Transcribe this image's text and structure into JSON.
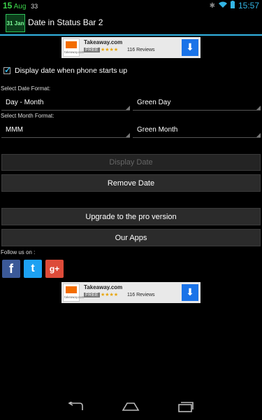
{
  "status_bar": {
    "date_day": "15",
    "date_month": "Aug",
    "battery_left": "33",
    "time": "15:57"
  },
  "action_bar": {
    "icon_text": "31 Jan",
    "title": "Date in Status Bar 2"
  },
  "ads": [
    {
      "name": "Takeaway.com",
      "free": "FREE",
      "stars": "★★★★",
      "reviews": "116 Reviews",
      "logo_text": "takeaway.com"
    },
    {
      "name": "Takeaway.com",
      "free": "FREE",
      "stars": "★★★★",
      "reviews": "116 Reviews",
      "logo_text": "takeaway.com"
    }
  ],
  "startup": {
    "label": "Display date when phone starts up",
    "checked": true
  },
  "date_format": {
    "label": "Select Date Format:",
    "format_value": "Day - Month",
    "color_value": "Green Day"
  },
  "month_format": {
    "label": "Select Month Format:",
    "format_value": "MMM",
    "color_value": "Green Month"
  },
  "buttons": {
    "display_date": "Display Date",
    "remove_date": "Remove Date",
    "upgrade": "Upgrade to the pro version",
    "our_apps": "Our Apps"
  },
  "follow": {
    "label": "Follow us on :",
    "facebook": "f",
    "twitter": "t",
    "google_plus": "g+"
  },
  "colors": {
    "accent": "#33b5e5",
    "facebook": "#3b5998",
    "twitter": "#1da1f2",
    "google_plus": "#dd4b39"
  }
}
